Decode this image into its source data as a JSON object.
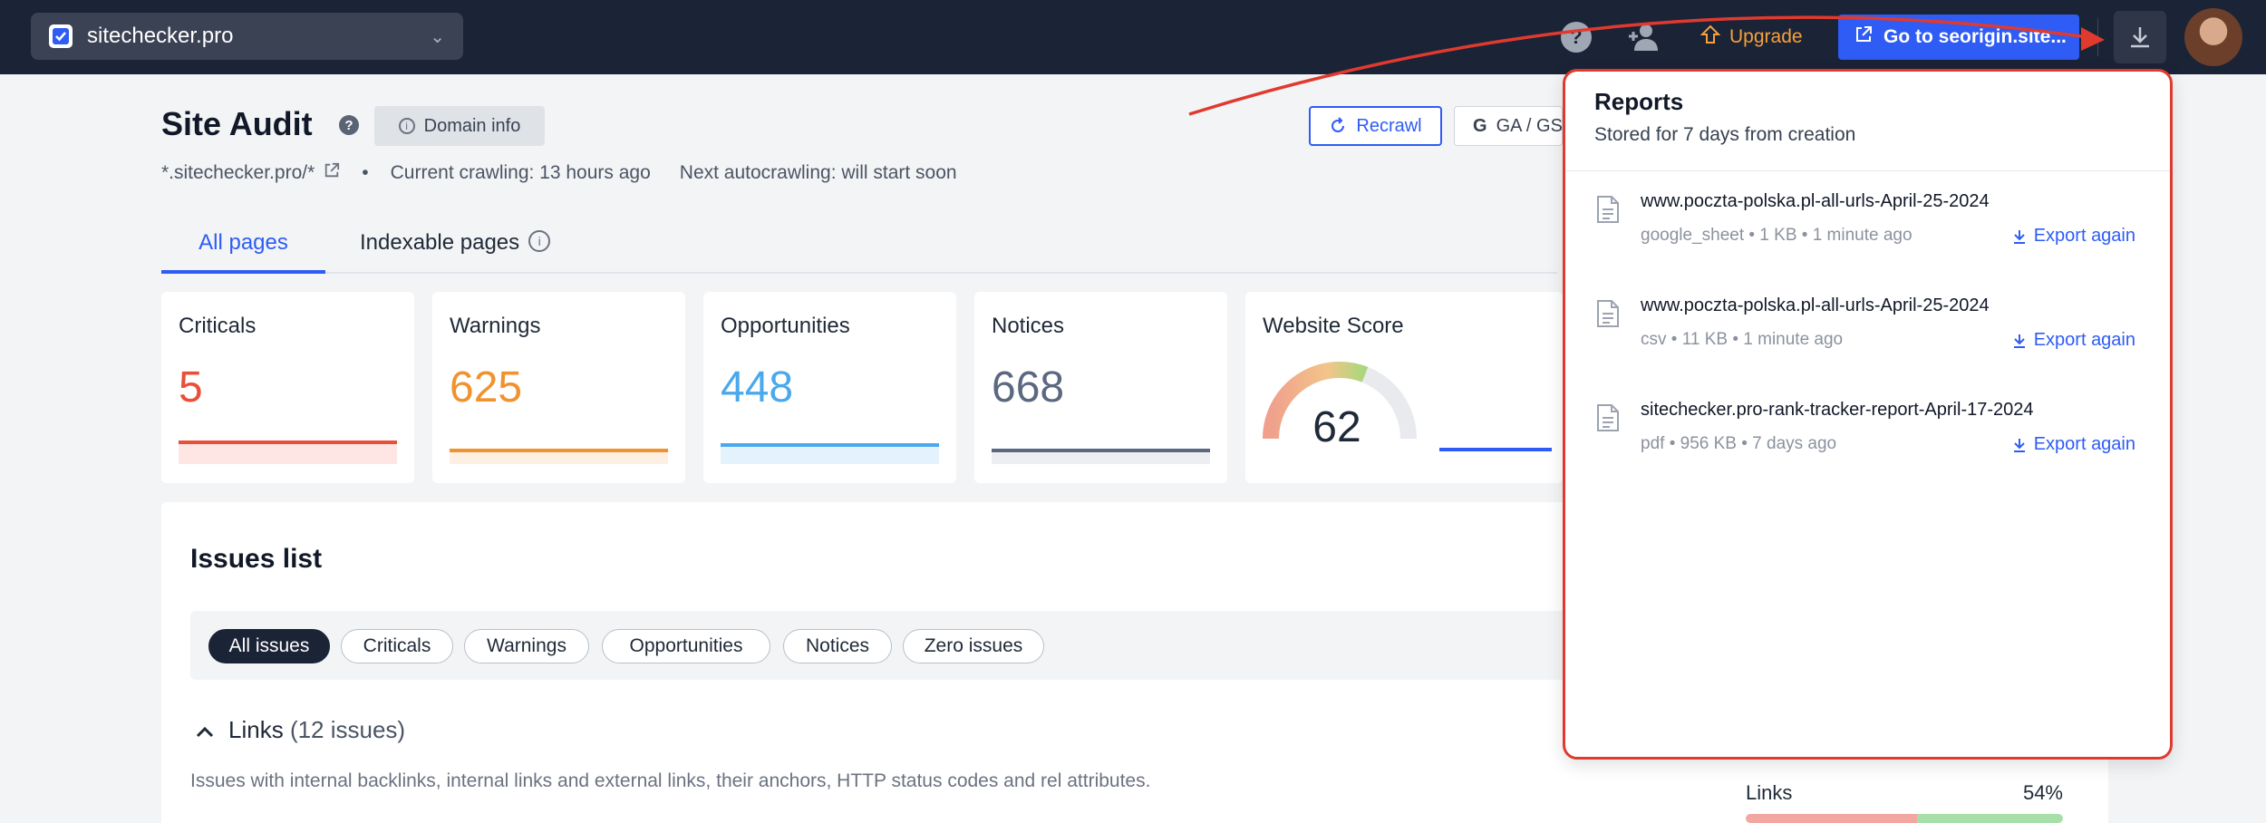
{
  "topbar": {
    "site": "sitechecker.pro",
    "upgrade_label": "Upgrade",
    "goto_label": "Go to seorigin.site..."
  },
  "header": {
    "title": "Site Audit",
    "domain_info_label": "Domain info",
    "recrawl_label": "Recrawl",
    "ga_label": "GA / GS",
    "domain": "*.sitechecker.pro/*",
    "bullet": "•",
    "current_crawling": "Current crawling: 13 hours ago",
    "next_autocrawling": "Next autocrawling: will start soon"
  },
  "tabs": [
    {
      "label": "All pages",
      "active": true
    },
    {
      "label": "Indexable pages",
      "active": false
    }
  ],
  "stats": [
    {
      "label": "Criticals",
      "value": "5",
      "color": "#e8503a",
      "fill": "#fde6e3"
    },
    {
      "label": "Warnings",
      "value": "625",
      "color": "#f0922e",
      "fill": "#fdf0e2"
    },
    {
      "label": "Opportunities",
      "value": "448",
      "color": "#4aa8ec",
      "fill": "#e3f2fd"
    },
    {
      "label": "Notices",
      "value": "668",
      "color": "#5c6780",
      "fill": "#eceef2"
    }
  ],
  "website_score": {
    "label": "Website Score",
    "value": "62",
    "fraction": 0.62
  },
  "issues": {
    "title": "Issues list",
    "filters": [
      "All issues",
      "Criticals",
      "Warnings",
      "Opportunities",
      "Notices",
      "Zero issues"
    ],
    "active_filter": 0,
    "group": {
      "name": "Links",
      "count": "(12 issues)",
      "description": "Issues with internal backlinks, internal links and external links, their anchors, HTTP status codes and rel attributes.",
      "metric_label": "Links",
      "metric_value": "54%",
      "metric_fraction": 0.54
    }
  },
  "reports": {
    "title": "Reports",
    "subtitle": "Stored for 7 days from creation",
    "export_label": "Export again",
    "items": [
      {
        "name": "www.poczta-polska.pl-all-urls-April-25-2024",
        "meta": "google_sheet • 1 KB • 1 minute ago"
      },
      {
        "name": "www.poczta-polska.pl-all-urls-April-25-2024",
        "meta": "csv • 11 KB • 1 minute ago"
      },
      {
        "name": "sitechecker.pro-rank-tracker-report-April-17-2024",
        "meta": "pdf • 956 KB • 7 days ago"
      }
    ]
  },
  "colors": {
    "topbar_bg": "#1b2336",
    "accent": "#2e5cf5",
    "annotation_red": "#e03a2f",
    "upgrade": "#f6a13a"
  }
}
